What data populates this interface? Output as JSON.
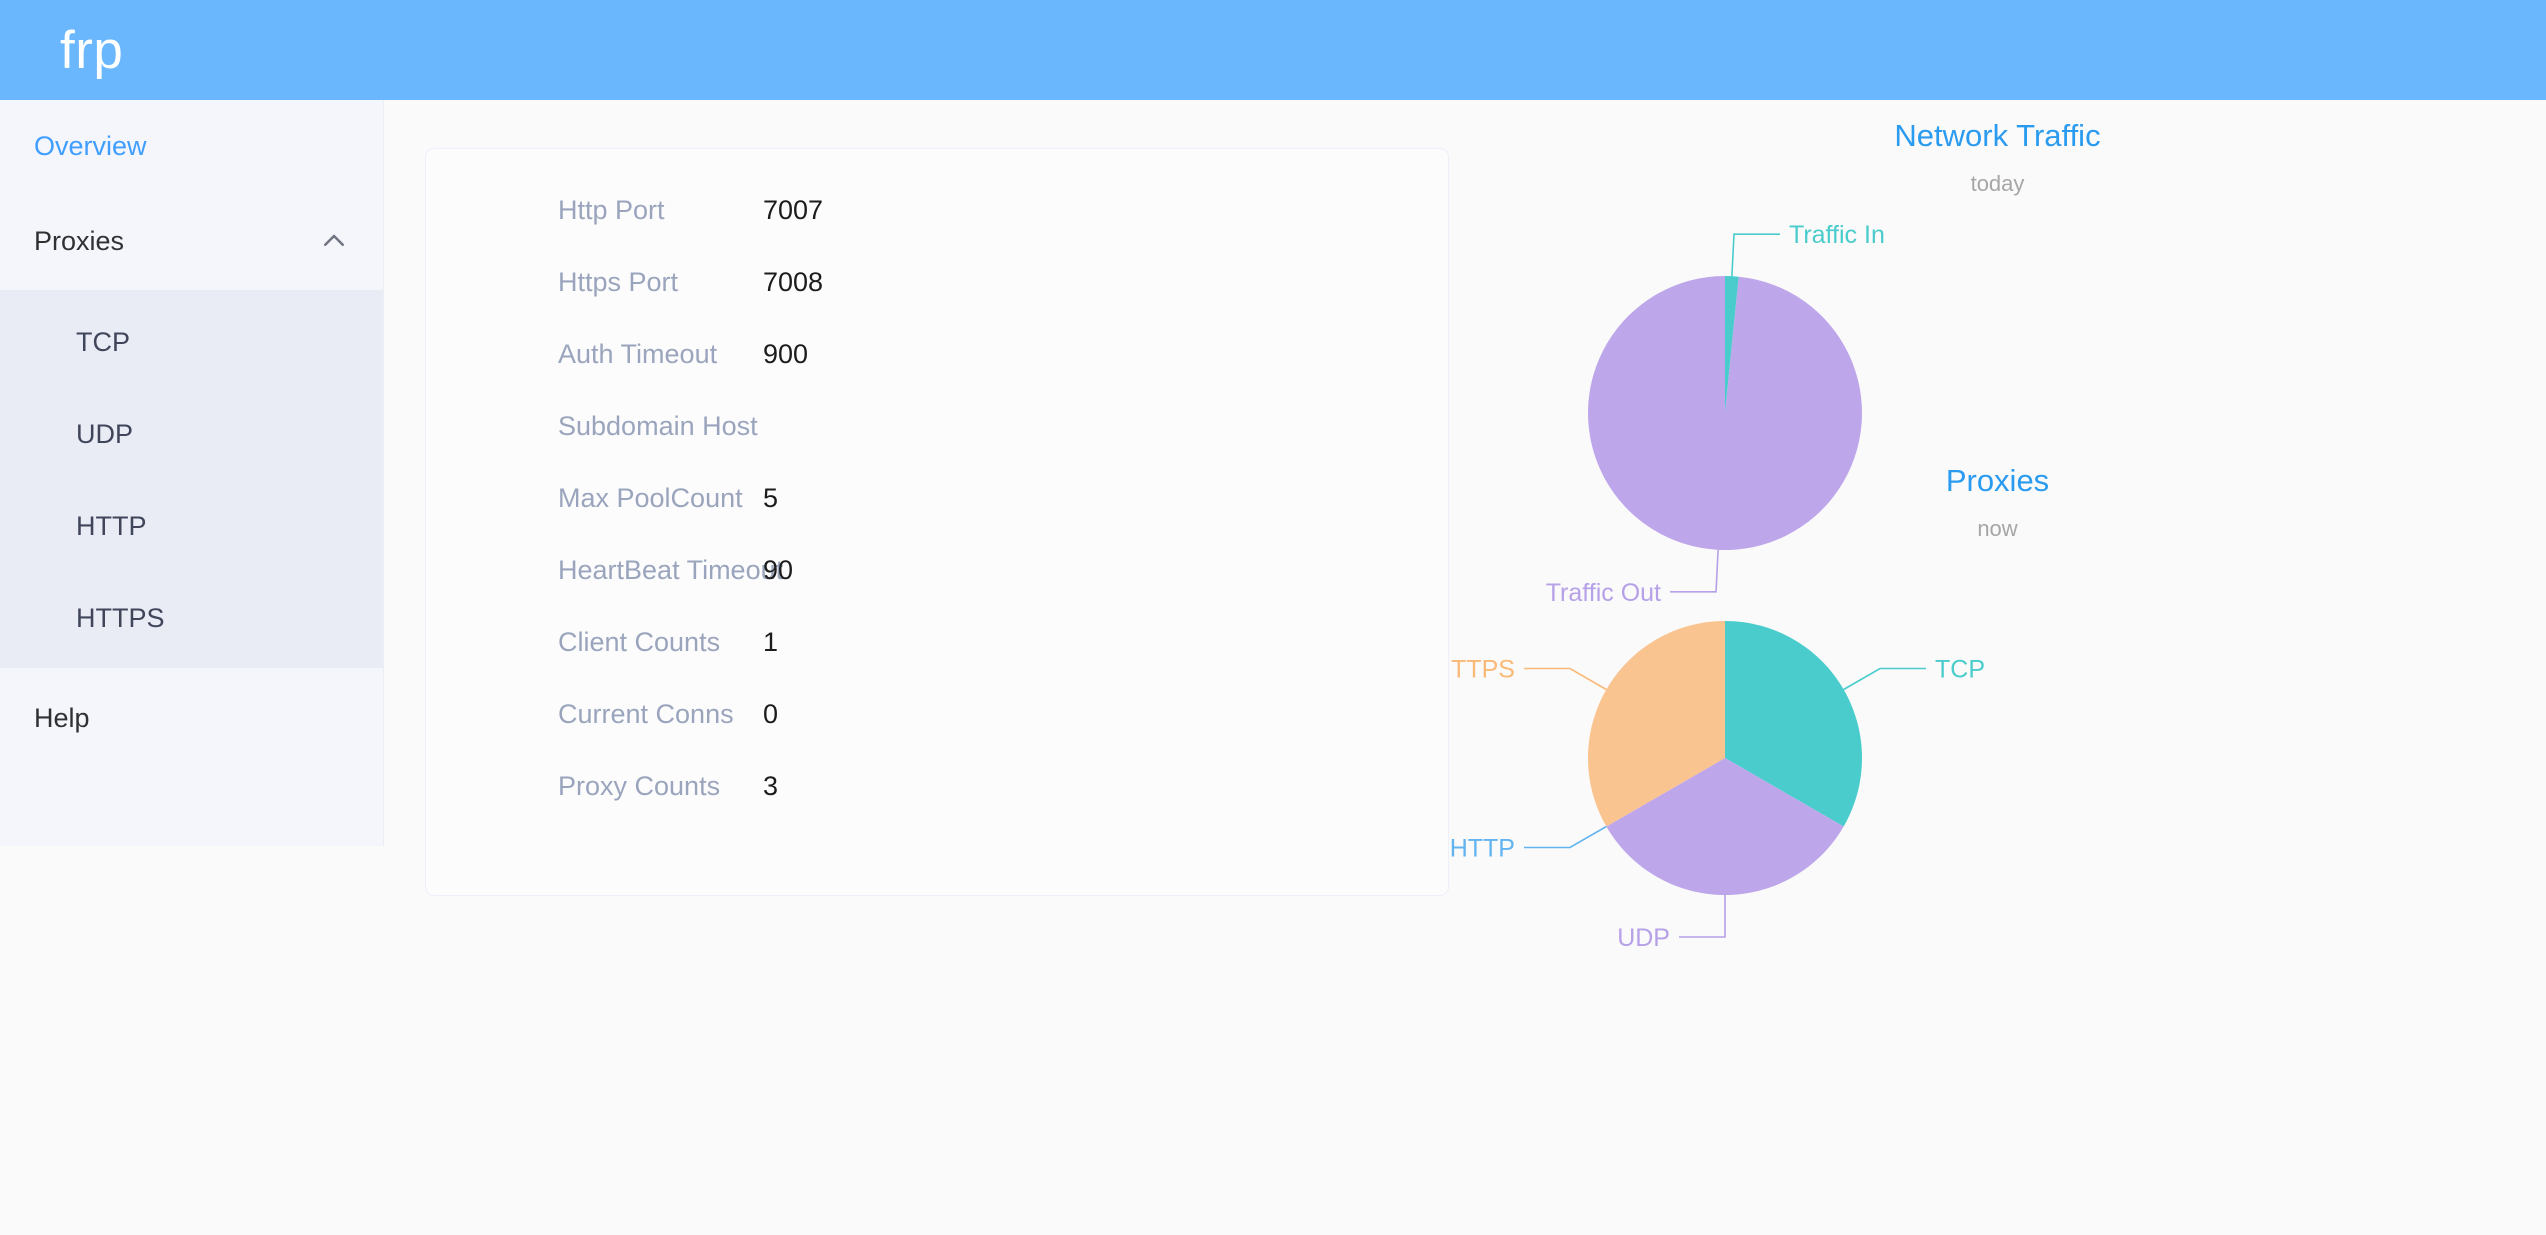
{
  "header": {
    "title": "frp"
  },
  "sidebar": {
    "overview": {
      "label": "Overview"
    },
    "proxies": {
      "label": "Proxies",
      "expand_icon": "chevron-up-icon"
    },
    "submenu": [
      {
        "label": "TCP"
      },
      {
        "label": "UDP"
      },
      {
        "label": "HTTP"
      },
      {
        "label": "HTTPS"
      }
    ],
    "help": {
      "label": "Help"
    }
  },
  "server_info": {
    "rows": [
      {
        "label": "Http Port",
        "value": "7007"
      },
      {
        "label": "Https Port",
        "value": "7008"
      },
      {
        "label": "Auth Timeout",
        "value": "900"
      },
      {
        "label": "Subdomain Host",
        "value": ""
      },
      {
        "label": "Max PoolCount",
        "value": "5"
      },
      {
        "label": "HeartBeat Timeout",
        "value": "90"
      },
      {
        "label": "Client Counts",
        "value": "1"
      },
      {
        "label": "Current Conns",
        "value": "0"
      },
      {
        "label": "Proxy Counts",
        "value": "3"
      }
    ]
  },
  "colors": {
    "header_blue": "#6ab7fe",
    "primary_blue": "#409eff",
    "chart_title_blue": "#2b9bf0",
    "teal": "#4acccd",
    "purple": "#bea6eb",
    "orange": "#f9c490",
    "http_blue": "#62b4f0",
    "label_gray": "#9aa5bd",
    "subtitle_gray": "#a6a6a6"
  },
  "chart_data": [
    {
      "type": "pie",
      "id": "network-traffic",
      "title": "Network Traffic",
      "subtitle": "today",
      "legend": "labels-with-leader-lines",
      "categories": [
        "Traffic In",
        "Traffic Out"
      ],
      "values": [
        1.6,
        98.4
      ],
      "value_unit": "percent",
      "colors": [
        "#4acccd",
        "#bea6eb"
      ],
      "label_colors": [
        "#4acccd",
        "#b6a0e8"
      ],
      "start_angle_deg": 0,
      "center": [
        276,
        218
      ],
      "radius": 137
    },
    {
      "type": "pie",
      "id": "proxies",
      "title": "Proxies",
      "subtitle": "now",
      "legend": "labels-with-leader-lines",
      "categories": [
        "TCP",
        "UDP",
        "HTTP",
        "HTTPS"
      ],
      "values": [
        1,
        1,
        0,
        1
      ],
      "value_unit": "count",
      "colors": [
        "#4acccd",
        "#bea6eb",
        "#62b4f0",
        "#f9c490"
      ],
      "label_colors": [
        "#4acccd",
        "#b6a0e8",
        "#62b4f0",
        "#f9b977"
      ],
      "start_angle_deg": 0,
      "center": [
        276,
        218
      ],
      "radius": 137
    }
  ]
}
